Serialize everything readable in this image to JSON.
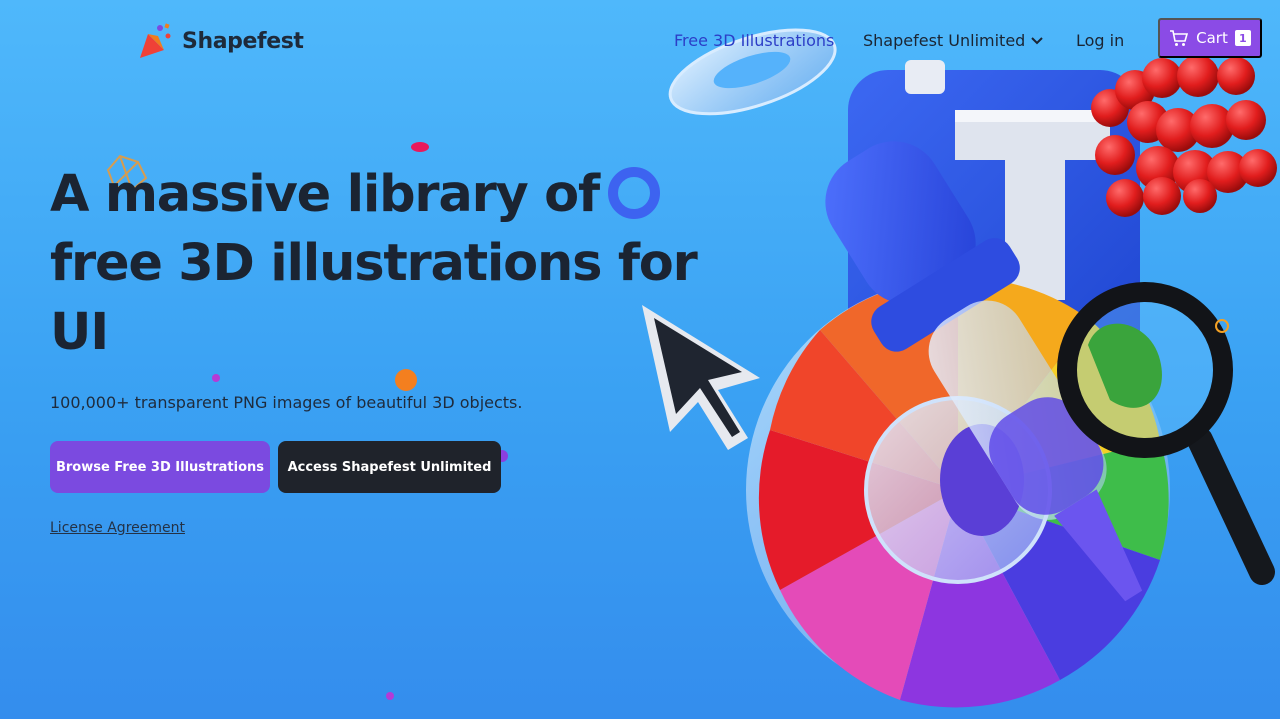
{
  "brand": {
    "name": "Shapefest"
  },
  "nav": {
    "links": [
      {
        "label": "Free 3D Illustrations"
      },
      {
        "label": "Shapefest Unlimited"
      },
      {
        "label": "Log in"
      }
    ],
    "cart_label": "Cart",
    "cart_count": "1"
  },
  "hero": {
    "headline_line1": "A massive library of",
    "headline_line2": "free 3D illustrations for",
    "headline_line3": "UI",
    "subtitle": "100,000+ transparent PNG images of beautiful 3D objects.",
    "primary_button": "Browse Free 3D Illustrations",
    "secondary_button": "Access Shapefest Unlimited",
    "license_link": "License Agreement"
  },
  "colors": {
    "accent": "#8b4be6",
    "primary_button": "#7b4ae0",
    "dark_button": "#1f232b",
    "background": "#3ba4f4"
  },
  "icons": [
    "shapefest-logo-icon",
    "chevron-down-icon",
    "cart-icon"
  ]
}
